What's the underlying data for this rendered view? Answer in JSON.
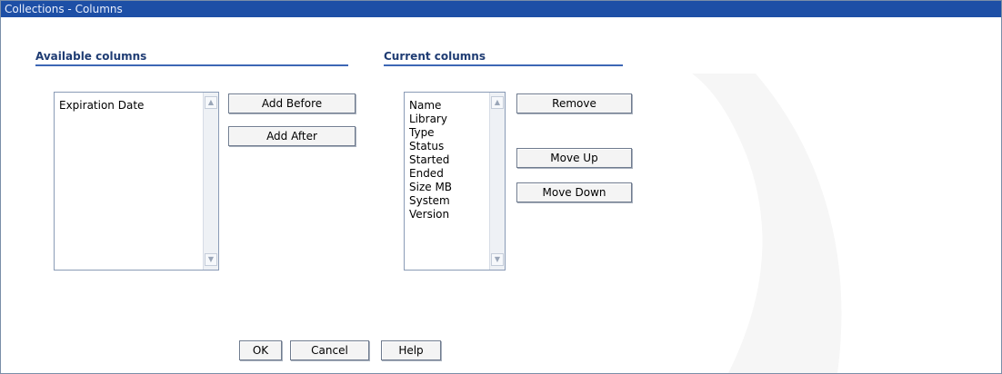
{
  "window": {
    "title": "Collections - Columns"
  },
  "available": {
    "heading": "Available columns",
    "items": [
      "Expiration Date"
    ]
  },
  "current": {
    "heading": "Current columns",
    "items": [
      "Name",
      "Library",
      "Type",
      "Status",
      "Started",
      "Ended",
      "Size MB",
      "System",
      "Version"
    ]
  },
  "buttons": {
    "add_before": "Add Before",
    "add_after": "Add After",
    "remove": "Remove",
    "move_up": "Move Up",
    "move_down": "Move Down",
    "ok": "OK",
    "cancel": "Cancel",
    "help": "Help"
  },
  "icons": {
    "scroll_up": "chevron-up-icon",
    "scroll_down": "chevron-down-icon"
  },
  "colors": {
    "title_bar": "#1d4fa6",
    "heading_text": "#1f3c73",
    "heading_rule": "#3d67b5"
  }
}
